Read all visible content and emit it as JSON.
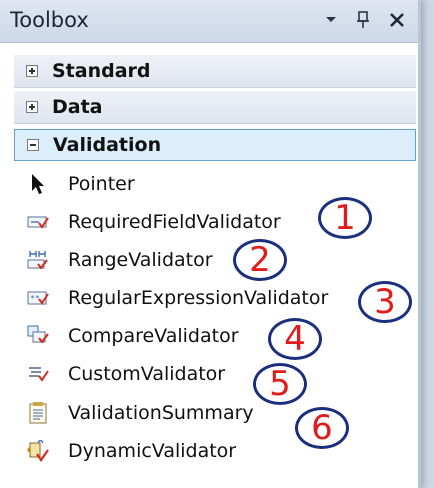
{
  "window": {
    "title": "Toolbox"
  },
  "groups": [
    {
      "label": "Standard",
      "state": "collapsed"
    },
    {
      "label": "Data",
      "state": "collapsed"
    },
    {
      "label": "Validation",
      "state": "expanded"
    }
  ],
  "items": [
    {
      "label": "Pointer",
      "icon": "pointer-arrow-icon"
    },
    {
      "label": "RequiredFieldValidator",
      "icon": "required-field-validator-icon"
    },
    {
      "label": "RangeValidator",
      "icon": "range-validator-icon"
    },
    {
      "label": "RegularExpressionValidator",
      "icon": "regex-validator-icon"
    },
    {
      "label": "CompareValidator",
      "icon": "compare-validator-icon"
    },
    {
      "label": "CustomValidator",
      "icon": "custom-validator-icon"
    },
    {
      "label": "ValidationSummary",
      "icon": "validation-summary-icon"
    },
    {
      "label": "DynamicValidator",
      "icon": "dynamic-validator-icon"
    }
  ],
  "callouts": [
    "1",
    "2",
    "3",
    "4",
    "5",
    "6"
  ],
  "colors": {
    "callout_ring": "#1b2f7e",
    "callout_number": "#e21b1b",
    "active_group_border": "#62a0d6",
    "active_group_fill": "#ddeefb"
  }
}
